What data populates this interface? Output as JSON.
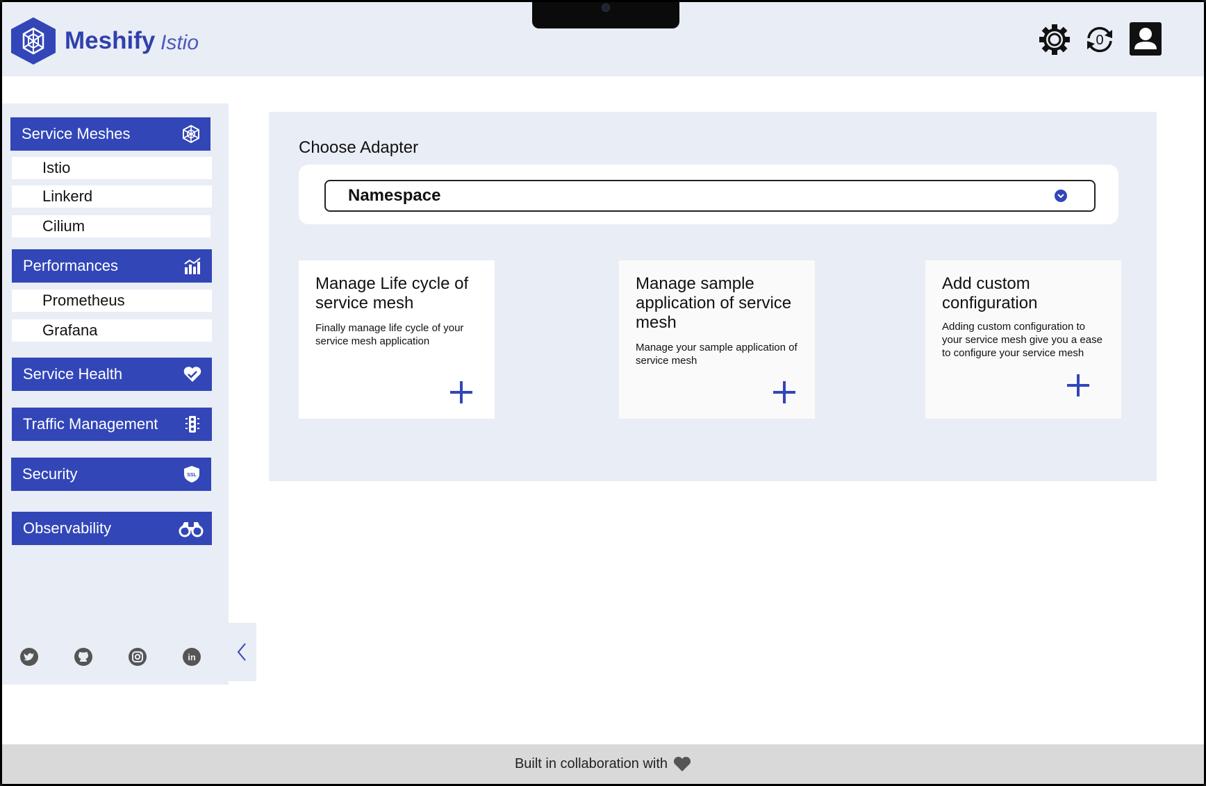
{
  "header": {
    "brand": "Meshify",
    "sub_brand": "Istio",
    "icons": [
      "settings-gear-icon",
      "sync-icon",
      "user-account-icon"
    ],
    "notification_count": "0"
  },
  "sidebar": {
    "sections": [
      {
        "label": "Service Meshes",
        "icon": "mesh-web-icon",
        "items": [
          "Istio",
          "Linkerd",
          "Cilium"
        ]
      },
      {
        "label": "Performances",
        "icon": "bar-chart-icon",
        "items": [
          "Prometheus",
          "Grafana"
        ]
      },
      {
        "label": "Service Health",
        "icon": "heart-check-icon",
        "items": []
      },
      {
        "label": "Traffic Management",
        "icon": "traffic-light-icon",
        "items": []
      },
      {
        "label": "Security",
        "icon": "ssl-shield-icon",
        "items": []
      },
      {
        "label": "Observability",
        "icon": "binoculars-icon",
        "items": []
      }
    ],
    "social": [
      "twitter-icon",
      "github-icon",
      "instagram-icon",
      "linkedin-icon"
    ],
    "collapse_icon": "chevron-left-icon"
  },
  "main": {
    "title": "Choose Adapter",
    "select_value": "Namespace",
    "cards": [
      {
        "title": "Manage Life cycle of service mesh",
        "description": "Finally manage life cycle of your service mesh application"
      },
      {
        "title": "Manage sample application of  service mesh",
        "description": "Manage your sample application of service mesh"
      },
      {
        "title": "Add custom configuration",
        "description": "Adding custom configuration to your service mesh give you a ease to configure your service mesh"
      }
    ]
  },
  "footer": {
    "text": "Built in collaboration with",
    "icon": "heart-icon"
  },
  "colors": {
    "primary": "#3246b8",
    "panel_bg": "#e9edf5",
    "footer_bg": "#d9d9d9"
  }
}
